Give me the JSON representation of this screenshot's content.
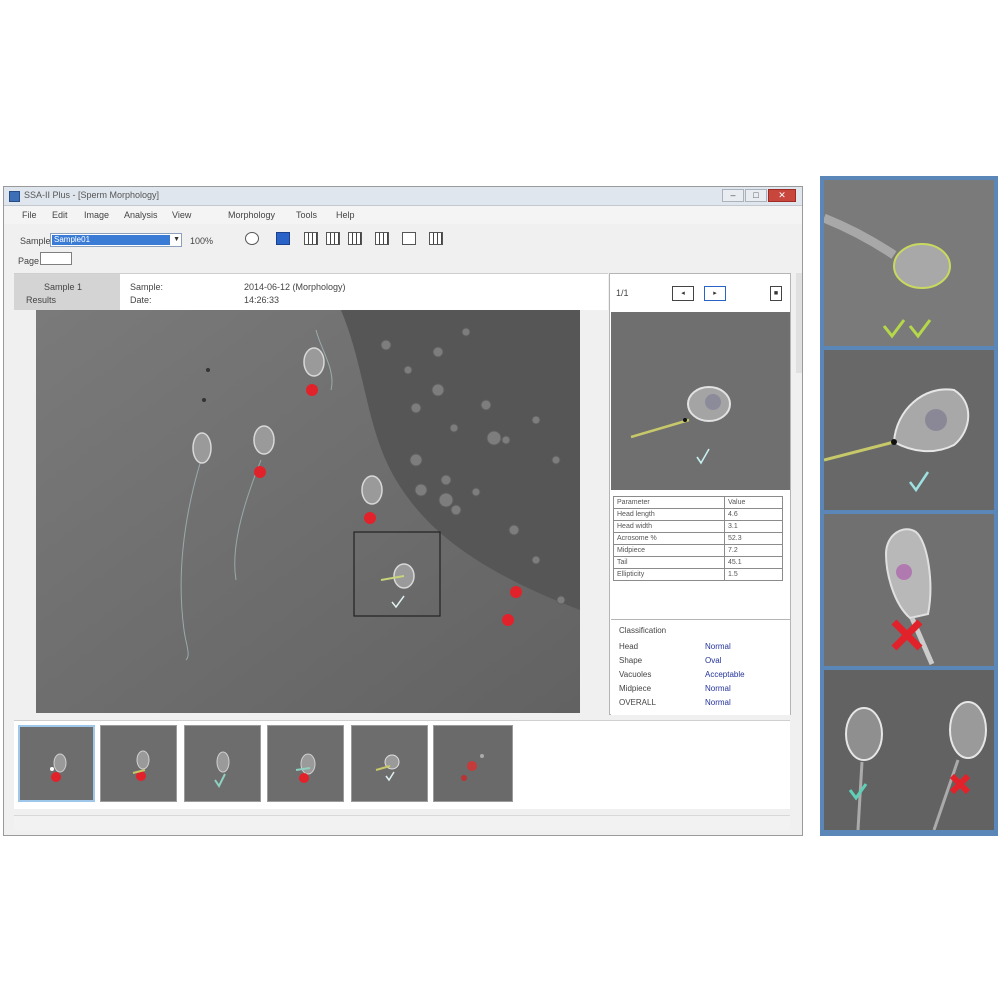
{
  "window": {
    "title": "SSA-II Plus - [Sperm Morphology]",
    "min_label": "–",
    "max_label": "□",
    "close_label": "✕"
  },
  "menu": [
    "File",
    "Edit",
    "Image",
    "Analysis",
    "View",
    "Morphology",
    "Tools",
    "Help"
  ],
  "toolbar": {
    "field_label": "Sample",
    "field_value": "Sample01",
    "zoom_label": "100%",
    "page_label": "Page"
  },
  "info": {
    "left_rows": [
      "Sample 1",
      "Results"
    ],
    "keys": [
      "Sample:",
      "Date:"
    ],
    "values": [
      "2014-06-12 (Morphology)",
      "14:26:33"
    ]
  },
  "panel": {
    "label": "1/1",
    "meas_rows": [
      [
        "Parameter",
        "Value"
      ],
      [
        "Head length",
        "4.6"
      ],
      [
        "Head width",
        "3.1"
      ],
      [
        "Acrosome %",
        "52.3"
      ],
      [
        "Midpiece",
        "7.2"
      ],
      [
        "Tail",
        "45.1"
      ],
      [
        "Ellipticity",
        "1.5"
      ]
    ],
    "result_title": "Classification",
    "results": [
      {
        "k": "Head",
        "v": "Normal"
      },
      {
        "k": "Shape",
        "v": "Oval"
      },
      {
        "k": "Vacuoles",
        "v": "Acceptable"
      },
      {
        "k": "Midpiece",
        "v": "Normal"
      },
      {
        "k": "OVERALL",
        "v": "Normal"
      }
    ]
  },
  "colors": {
    "normal_mark": "#8fd0c0",
    "abnormal_mark": "#e2222b",
    "accent": "#3a7bd5",
    "side_border": "#5b86b8"
  },
  "thumbnails": [
    "abnormal",
    "abnormal",
    "normal",
    "abnormal",
    "normal",
    "abnormal"
  ]
}
